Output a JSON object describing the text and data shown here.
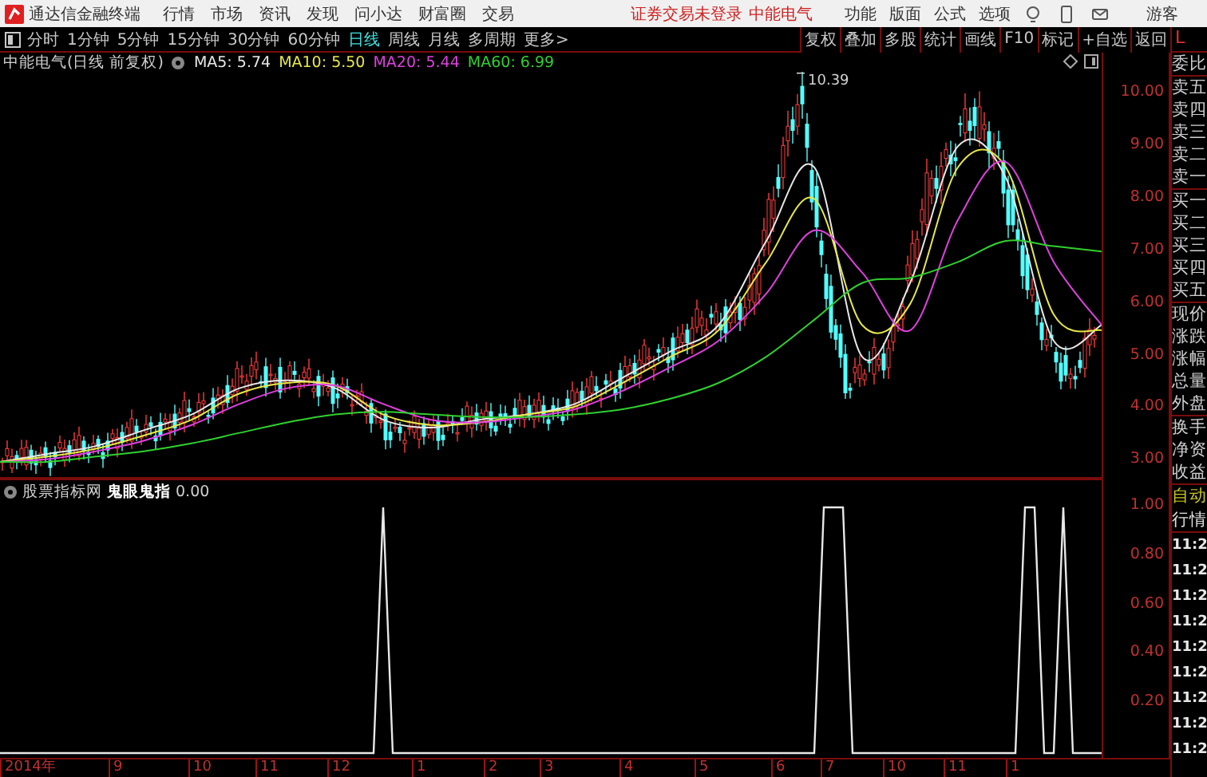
{
  "app": {
    "title": "通达信金融终端",
    "menu": [
      "行情",
      "市场",
      "资讯",
      "发现",
      "问小达",
      "财富圈",
      "交易"
    ],
    "login_status": "证券交易未登录",
    "stock_link": "中能电气",
    "tools": [
      "功能",
      "版面",
      "公式",
      "选项"
    ],
    "user": "游客"
  },
  "periods": [
    {
      "label": "分时",
      "selected": false
    },
    {
      "label": "1分钟",
      "selected": false
    },
    {
      "label": "5分钟",
      "selected": false
    },
    {
      "label": "15分钟",
      "selected": false
    },
    {
      "label": "30分钟",
      "selected": false
    },
    {
      "label": "60分钟",
      "selected": false
    },
    {
      "label": "日线",
      "selected": true
    },
    {
      "label": "周线",
      "selected": false
    },
    {
      "label": "月线",
      "selected": false
    },
    {
      "label": "多周期",
      "selected": false
    },
    {
      "label": "更多>",
      "selected": false
    }
  ],
  "chart_tools": [
    "复权",
    "叠加",
    "多股",
    "统计",
    "画线",
    "F10",
    "标记",
    "+自选",
    "返回"
  ],
  "chart": {
    "chart_data": {
      "type": "line",
      "ylim": [
        2.68,
        10.78
      ],
      "yticks": [
        {
          "value": 10,
          "label": "10.00"
        },
        {
          "value": 9,
          "label": "9.00"
        },
        {
          "value": 8,
          "label": "8.00"
        },
        {
          "value": 7,
          "label": "7.00"
        },
        {
          "value": 6,
          "label": "6.00"
        },
        {
          "value": 5,
          "label": "5.00"
        },
        {
          "value": 4,
          "label": "4.00"
        },
        {
          "value": 3,
          "label": "3.00"
        }
      ],
      "series": [
        {
          "color": "#e8e8e8",
          "values": [
            3.0,
            3.15,
            3.3,
            3.6,
            3.9,
            4.4,
            4.55,
            4.4,
            3.8,
            3.65,
            3.8,
            3.9,
            4.1,
            4.6,
            5.1,
            5.6,
            7.2,
            8.6,
            5.0,
            6.4,
            9.0,
            8.4,
            5.3,
            5.6
          ]
        },
        {
          "color": "#e8e84a",
          "values": [
            3.0,
            3.1,
            3.25,
            3.5,
            3.8,
            4.3,
            4.5,
            4.45,
            3.9,
            3.7,
            3.75,
            3.9,
            4.05,
            4.5,
            5.0,
            5.5,
            6.8,
            8.0,
            5.6,
            6.0,
            8.6,
            8.6,
            5.8,
            5.5
          ]
        },
        {
          "color": "#e040e0",
          "values": [
            3.0,
            3.05,
            3.2,
            3.4,
            3.7,
            4.1,
            4.4,
            4.45,
            4.1,
            3.8,
            3.75,
            3.85,
            4.0,
            4.35,
            4.8,
            5.3,
            6.2,
            7.4,
            6.6,
            5.5,
            7.6,
            8.7,
            6.8,
            5.6
          ]
        },
        {
          "color": "#30d030",
          "values": [
            3.0,
            3.0,
            3.1,
            3.2,
            3.35,
            3.55,
            3.75,
            3.9,
            3.95,
            3.9,
            3.85,
            3.85,
            3.9,
            4.0,
            4.2,
            4.5,
            5.0,
            5.7,
            6.4,
            6.5,
            6.8,
            7.2,
            7.1,
            7.0
          ]
        }
      ]
    },
    "title": "中能电气(日线 前复权)",
    "ma": [
      {
        "label": "MA5: 5.74"
      },
      {
        "label": "MA10: 5.50"
      },
      {
        "label": "MA20: 5.44"
      },
      {
        "label": "MA60: 6.99"
      }
    ],
    "peak_label": "10.39"
  },
  "indicator": {
    "source": "股票指标网",
    "name": "鬼眼鬼指",
    "value": "0.00",
    "chart_data": {
      "type": "line",
      "ylim": [
        -0.013,
        1.117
      ],
      "yticks": [
        {
          "value": 1,
          "label": "1.00"
        },
        {
          "value": 0.8,
          "label": "0.80"
        },
        {
          "value": 0.6,
          "label": "0.60"
        },
        {
          "value": 0.4,
          "label": "0.40"
        },
        {
          "value": 0.2,
          "label": "0.20"
        }
      ],
      "series": [
        {
          "color": "#e8e8e8",
          "values": [
            0,
            0,
            0,
            0,
            0,
            0,
            0,
            0,
            0,
            0,
            0,
            0,
            0,
            0,
            0,
            0,
            0,
            0,
            0,
            0,
            0,
            0,
            0,
            0,
            0,
            0,
            0,
            0,
            0,
            0,
            0,
            0,
            0,
            0,
            0,
            0,
            0,
            0,
            0,
            0,
            1,
            0,
            0,
            0,
            0,
            0,
            0,
            0,
            0,
            0,
            0,
            0,
            0,
            0,
            0,
            0,
            0,
            0,
            0,
            0,
            0,
            0,
            0,
            0,
            0,
            0,
            0,
            0,
            0,
            0,
            0,
            0,
            0,
            0,
            0,
            0,
            0,
            0,
            0,
            0,
            0,
            0,
            0,
            0,
            0,
            0,
            1,
            1,
            1,
            0,
            0,
            0,
            0,
            0,
            0,
            0,
            0,
            0,
            0,
            0,
            0,
            0,
            0,
            0,
            0,
            0,
            0,
            1,
            1,
            0,
            0,
            1,
            0,
            0,
            0,
            0
          ]
        }
      ]
    }
  },
  "date_axis": [
    "2014年",
    "9",
    "10",
    "11",
    "12",
    "1",
    "2",
    "3",
    "4",
    "5",
    "6",
    "7",
    "10",
    "11",
    "1"
  ],
  "quote_panel": {
    "header": "L",
    "groups": [
      [
        "委比"
      ],
      [
        "卖五",
        "卖四",
        "卖三",
        "卖二",
        "卖一"
      ],
      [
        "买一",
        "买二",
        "买三",
        "买四",
        "买五"
      ],
      [
        "现价",
        "涨跌",
        "涨幅",
        "总量",
        "外盘"
      ],
      [
        "换手",
        "净资",
        "收益"
      ]
    ],
    "mode": "自动",
    "tab": "行情",
    "times": [
      "11:2",
      "11:2",
      "11:2",
      "11:2",
      "11:2",
      "11:2",
      "11:2",
      "11:2",
      "11:2"
    ]
  }
}
